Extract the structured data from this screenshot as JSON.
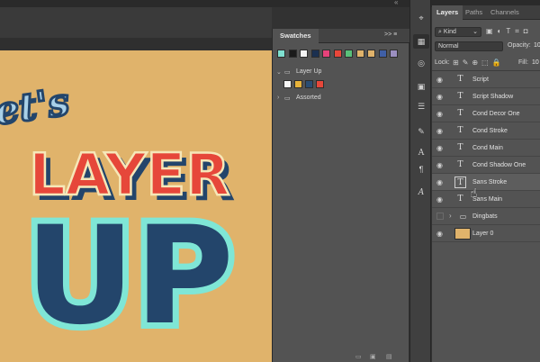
{
  "collapse_arrows": "«",
  "swatches": {
    "tab_label": "Swatches",
    "menu_glyph": ">> ≡",
    "recent_colors": [
      "#7fe0d0",
      "#1a1a1a",
      "#f4f4f4",
      "#1b3050",
      "#e6427a",
      "#e8473a",
      "#59c07a",
      "#e0b36b",
      "#e0b36b",
      "#3f5fa6",
      "#9b8fc0"
    ],
    "groups": [
      {
        "label": "Layer Up",
        "expanded": true,
        "colors": [
          "#f6f6f6",
          "#e7b23a",
          "#2a4d73",
          "#e6473a"
        ]
      },
      {
        "label": "Assorted",
        "expanded": false,
        "colors": []
      }
    ]
  },
  "layers": {
    "tabs": [
      "Layers",
      "Paths",
      "Channels"
    ],
    "active_tab": "Layers",
    "filter": {
      "label": "Kind",
      "icon": "search-icon"
    },
    "blend_mode": "Normal",
    "opacity": {
      "label": "Opacity:",
      "value": "10"
    },
    "lock_label": "Lock:",
    "fill": {
      "label": "Fill:",
      "value": "10"
    },
    "items": [
      {
        "name": "Script",
        "type": "text",
        "visible": true
      },
      {
        "name": "Script Shadow",
        "type": "text",
        "visible": true
      },
      {
        "name": "Cond Decor One",
        "type": "text",
        "visible": true
      },
      {
        "name": "Cond Stroke",
        "type": "text",
        "visible": true
      },
      {
        "name": "Cond Main",
        "type": "text",
        "visible": true
      },
      {
        "name": "Cond Shadow One",
        "type": "text",
        "visible": true
      },
      {
        "name": "Sans Stroke",
        "type": "text",
        "visible": true,
        "hover": true
      },
      {
        "name": "Sans Main",
        "type": "text",
        "visible": true
      },
      {
        "name": "Dingbats",
        "type": "group",
        "visible": false
      },
      {
        "name": "Layer 0",
        "type": "image",
        "visible": true,
        "thumb_color": "#e0b36b"
      }
    ]
  },
  "canvas_art": {
    "script_text": "et's",
    "line1": "LAYER",
    "line2": "UP",
    "background": "#e0b36b",
    "colors": {
      "red": "#e6473a",
      "navy": "#23456b",
      "teal": "#7fe6d6",
      "cream": "#f6e7b8",
      "shadow_blue": "#3f6fa8"
    }
  },
  "tools": [
    "eye-dropper-icon",
    "grid-icon",
    "adjust-icon",
    "library-icon",
    "properties-icon",
    "brush-icon",
    "character-icon",
    "paragraph-icon",
    "glyph-icon"
  ]
}
